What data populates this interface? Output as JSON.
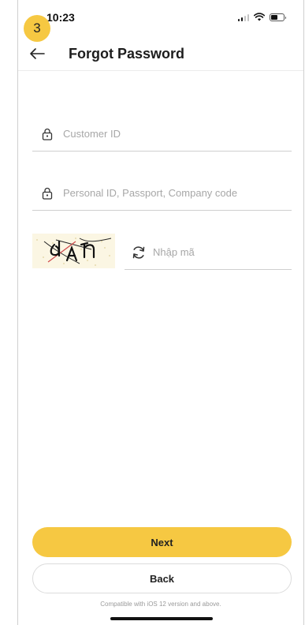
{
  "status_bar": {
    "time": "10:23",
    "battery_level": 0.55
  },
  "step_badge": "3",
  "header": {
    "title": "Forgot Password",
    "back_icon": "arrow-left-icon"
  },
  "form": {
    "customer_id": {
      "placeholder": "Customer ID",
      "value": "",
      "icon": "lock-icon"
    },
    "personal_id": {
      "placeholder": "Personal ID, Passport, Company code",
      "value": "",
      "icon": "lock-icon"
    },
    "captcha": {
      "placeholder": "Nhập mã",
      "value": "",
      "refresh_icon": "refresh-icon"
    }
  },
  "buttons": {
    "next_label": "Next",
    "back_label": "Back"
  },
  "footer": {
    "compat_text": "Compatible with iOS 12 version and above."
  },
  "colors": {
    "accent": "#f6c842",
    "divider": "#cfcfcf",
    "placeholder": "#a7a7a7"
  }
}
